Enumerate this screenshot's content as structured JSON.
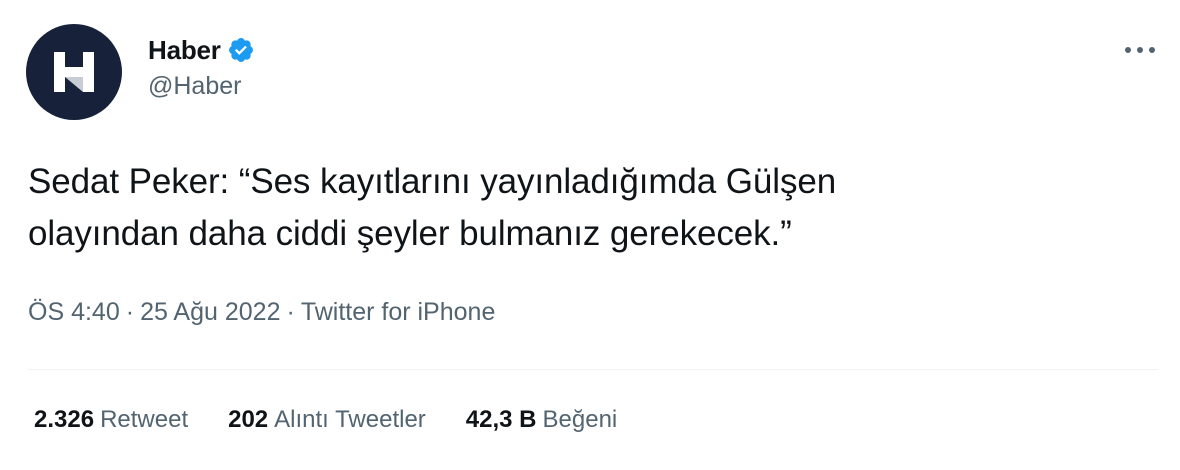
{
  "author": {
    "display_name": "Haber",
    "handle": "@Haber",
    "avatar_letter": "H",
    "verified": true
  },
  "tweet": {
    "text_line1": "Sedat Peker: “Ses kayıtlarını yayınladığımda Gülşen",
    "text_line2": "olayından daha ciddi şeyler bulmanız gerekecek.”",
    "time": "ÖS 4:40",
    "date": "25 Ağu 2022",
    "separator": "·",
    "source": "Twitter for iPhone"
  },
  "stats": {
    "retweets": {
      "count": "2.326",
      "label": "Retweet"
    },
    "quotes": {
      "count": "202",
      "label": "Alıntı Tweetler"
    },
    "likes": {
      "count": "42,3 B",
      "label": "Beğeni"
    }
  },
  "icons": {
    "more": "more-options-icon",
    "verified": "verified-badge-icon"
  },
  "colors": {
    "avatar_bg": "#17213a",
    "verified_blue": "#1d9bf0",
    "secondary_text": "#536471",
    "primary_text": "#0f1419",
    "divider": "#eff3f4"
  }
}
